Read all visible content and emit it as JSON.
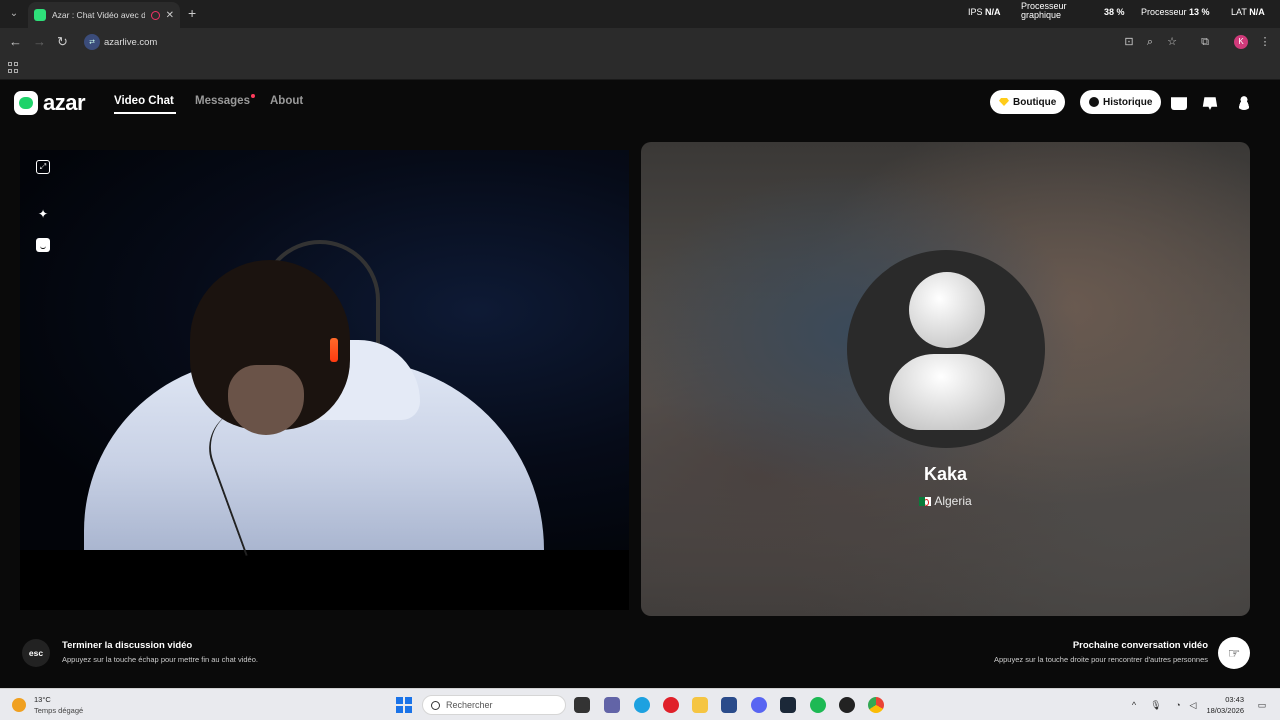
{
  "browser": {
    "tab_title": "Azar : Chat Vidéo avec de",
    "new_tab_symbol": "+",
    "url": "azarlive.com",
    "profile_initial": "K"
  },
  "overlay": {
    "ips_label": "IPS",
    "ips_value": "N/A",
    "gpu_label_1": "Processeur",
    "gpu_label_2": "graphique",
    "gpu_value": "38 %",
    "cpu_label": "Processeur",
    "cpu_value": "13 %",
    "lat_label": "LAT",
    "lat_value": "N/A"
  },
  "header": {
    "logo_text": "azar",
    "nav": [
      {
        "label": "Video Chat"
      },
      {
        "label": "Messages"
      },
      {
        "label": "About"
      }
    ],
    "boutique_label": "Boutique",
    "historique_label": "Historique"
  },
  "partner": {
    "name": "Kaka",
    "country": "Algeria"
  },
  "bottom": {
    "esc_key": "esc",
    "end_title": "Terminer la discussion vidéo",
    "end_sub": "Appuyez sur la touche échap pour mettre fin au chat vidéo.",
    "next_title": "Prochaine conversation vidéo",
    "next_sub": "Appuyez sur la touche droite pour rencontrer d'autres personnes"
  },
  "taskbar": {
    "weather_temp": "13°C",
    "weather_desc": "Temps dégagé",
    "search_placeholder": "Rechercher",
    "time": "03:43",
    "date": "18/03/2026"
  },
  "colors": {
    "brand_green": "#1fd36a",
    "notification_red": "#ff3b5c",
    "diamond_yellow": "#ffcc1a"
  }
}
